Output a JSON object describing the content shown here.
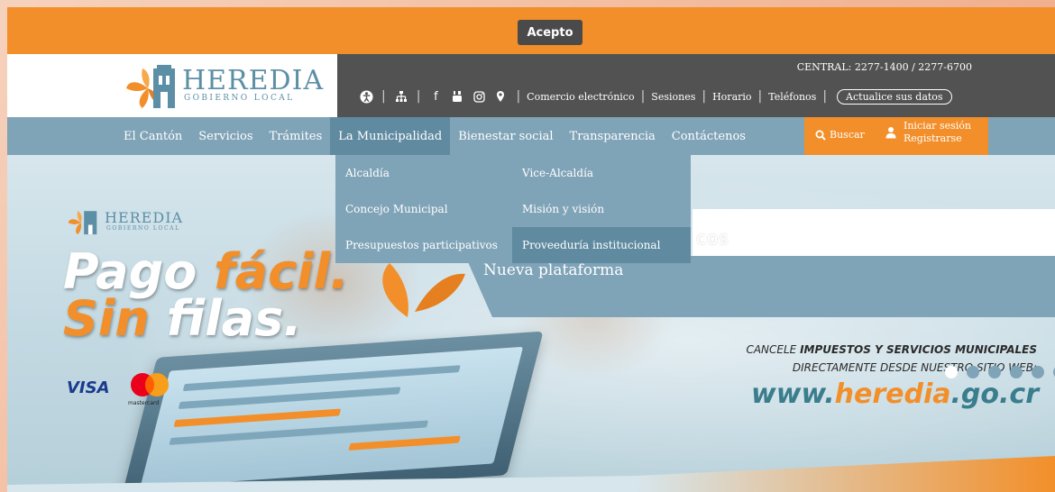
{
  "cookie": {
    "accept_label": "Acepto"
  },
  "logo": {
    "name": "HEREDIA",
    "subtitle": "GOBIERNO LOCAL"
  },
  "topbar": {
    "central": "CENTRAL: 2277-1400 / 2277-6700",
    "links": [
      "Comercio electrónico",
      "Sesiones",
      "Horario",
      "Teléfonos"
    ],
    "update_label": "Actualice sus datos",
    "icons": [
      "accessibility-icon",
      "sitemap-icon",
      "facebook-icon",
      "youtube-icon",
      "instagram-icon",
      "location-icon"
    ]
  },
  "nav": {
    "items": [
      {
        "label": "El Cantón"
      },
      {
        "label": "Servicios"
      },
      {
        "label": "Trámites"
      },
      {
        "label": "La Municipalidad"
      },
      {
        "label": "Bienestar social"
      },
      {
        "label": "Transparencia"
      },
      {
        "label": "Contáctenos"
      }
    ],
    "search_label": "Buscar",
    "login_label": "Iniciar sesión",
    "register_label": "Registrarse"
  },
  "dropdown": {
    "items": [
      {
        "label": "Alcaldía"
      },
      {
        "label": "Vice-Alcaldía"
      },
      {
        "label": "Concejo Municipal"
      },
      {
        "label": "Misión y visión"
      },
      {
        "label": "Presupuestos participativos"
      },
      {
        "label": "Proveeduría institucional"
      }
    ]
  },
  "hero": {
    "logo_name": "HEREDIA",
    "logo_sub": "GOBIERNO LOCAL",
    "pago": "Pago",
    "facil": "fácil.",
    "sin": "Sin",
    "filas": "filas.",
    "visa": "VISA",
    "mastercard": "mastercard",
    "banner_partial": "cos",
    "nueva": "Nueva plataforma",
    "cancele_prefix": "CANCELE",
    "cancele_bold": "IMPUESTOS Y SERVICIOS MUNICIPALES",
    "directamente": "DIRECTAMENTE DESDE NUESTRO SITIO WEB:",
    "www_prefix": "www.",
    "www_brand": "heredia",
    "www_suffix": ".go.cr"
  },
  "colors": {
    "orange": "#f28f2a",
    "steel_blue": "#7fa3b7",
    "dark_gray": "#525252",
    "teal": "#3a7d8c"
  }
}
